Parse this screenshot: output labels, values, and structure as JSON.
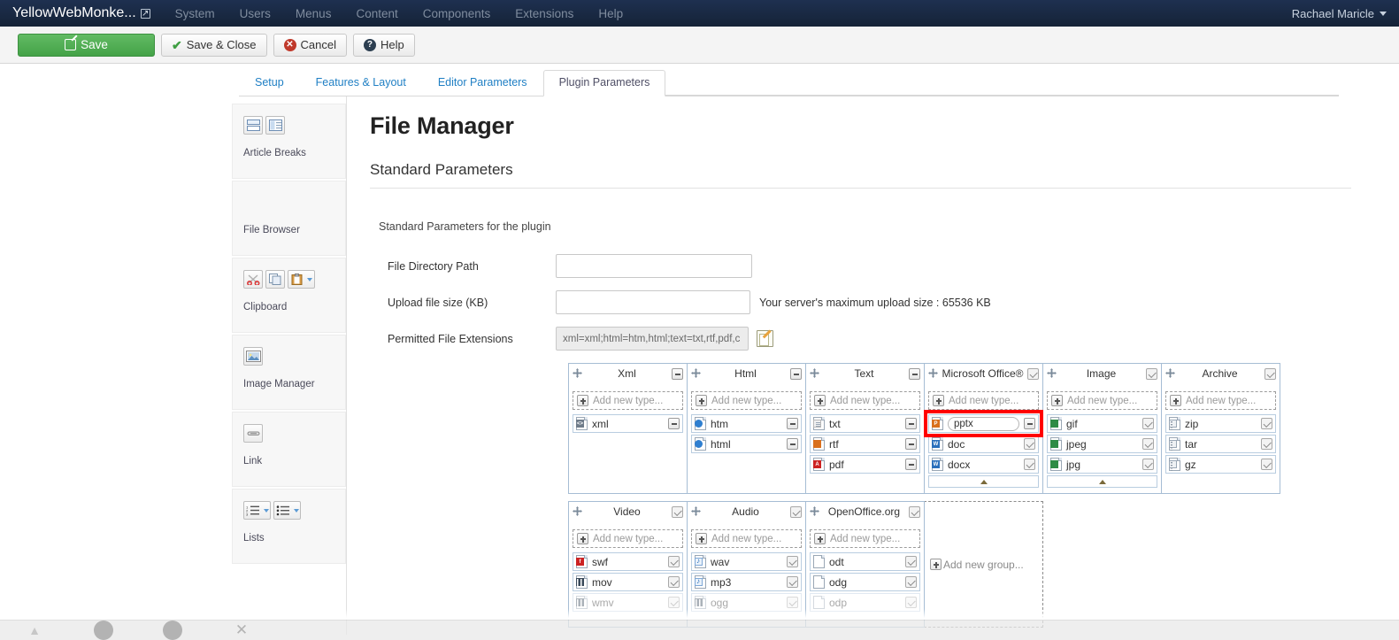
{
  "navbar": {
    "brand": "YellowWebMonke...",
    "brand_icon": "external-link-icon",
    "menu": [
      "System",
      "Users",
      "Menus",
      "Content",
      "Components",
      "Extensions",
      "Help"
    ],
    "user": "Rachael Maricle"
  },
  "toolbar": {
    "save_label": "Save",
    "save_close_label": "Save & Close",
    "cancel_label": "Cancel",
    "help_label": "Help"
  },
  "tabs": [
    {
      "label": "Setup",
      "active": false
    },
    {
      "label": "Features & Layout",
      "active": false
    },
    {
      "label": "Editor Parameters",
      "active": false
    },
    {
      "label": "Plugin Parameters",
      "active": true
    }
  ],
  "sidebar": {
    "items": [
      {
        "label": "Article Breaks",
        "icons": [
          "page-break-icon",
          "page-sidebar-icon"
        ]
      },
      {
        "label": "File Browser",
        "icons": []
      },
      {
        "label": "Clipboard",
        "icons": [
          "cut-scissors-icon",
          "copy-icon",
          "paste-icon"
        ]
      },
      {
        "label": "Image Manager",
        "icons": [
          "image-icon"
        ]
      },
      {
        "label": "Link",
        "icons": [
          "link-icon"
        ]
      },
      {
        "label": "Lists",
        "icons": [
          "ordered-list-icon",
          "unordered-list-icon"
        ]
      }
    ]
  },
  "main": {
    "page_title": "File Manager",
    "section_title": "Standard Parameters",
    "section_desc": "Standard Parameters for the plugin",
    "fields": [
      {
        "label": "File Directory Path",
        "value": "",
        "placeholder": ""
      },
      {
        "label": "Upload file size (KB)",
        "value": "",
        "placeholder": "",
        "helper": "Your server's maximum upload size : 65536 KB"
      },
      {
        "label": "Permitted File Extensions",
        "value": "xml=xml;html=htm,html;text=txt,rtf,pdf,c",
        "readonly": true,
        "edit_icon": "edit-pencil-icon"
      }
    ]
  },
  "groups": {
    "add_new_type_label": "Add new type...",
    "add_new_group_label": "Add new group...",
    "list": [
      {
        "title": "Xml",
        "head_ctl": "minus",
        "row_ctl": "minus",
        "scroll_up": false,
        "types": [
          {
            "label": "xml",
            "icon": "code-file-icon",
            "icon_class": "b-gray",
            "glyph": "<>"
          }
        ]
      },
      {
        "title": "Html",
        "head_ctl": "minus",
        "row_ctl": "minus",
        "scroll_up": false,
        "types": [
          {
            "label": "htm",
            "icon": "globe-file-icon",
            "icon_class": "b-globe",
            "glyph": ""
          },
          {
            "label": "html",
            "icon": "globe-file-icon",
            "icon_class": "b-globe",
            "glyph": ""
          }
        ]
      },
      {
        "title": "Text",
        "head_ctl": "minus",
        "row_ctl": "minus",
        "scroll_up": false,
        "types": [
          {
            "label": "txt",
            "icon": "text-file-icon",
            "icon_class": "b-lines",
            "glyph": ""
          },
          {
            "label": "rtf",
            "icon": "rtf-file-icon",
            "icon_class": "b-orange",
            "glyph": ""
          },
          {
            "label": "pdf",
            "icon": "pdf-file-icon",
            "icon_class": "b-red",
            "glyph": "A"
          }
        ]
      },
      {
        "title": "Microsoft Office®",
        "head_ctl": "check",
        "row_ctl": "check",
        "scroll_up": true,
        "types": [
          {
            "label": "pptx",
            "icon": "powerpoint-file-icon",
            "icon_class": "b-orange",
            "glyph": "P",
            "editing": true,
            "row_ctl": "minus",
            "highlighted": true
          },
          {
            "label": "doc",
            "icon": "word-file-icon",
            "icon_class": "b-blue",
            "glyph": "W"
          },
          {
            "label": "docx",
            "icon": "word-file-icon",
            "icon_class": "b-blue",
            "glyph": "W"
          }
        ]
      },
      {
        "title": "Image",
        "head_ctl": "check",
        "row_ctl": "check",
        "scroll_up": true,
        "types": [
          {
            "label": "gif",
            "icon": "image-file-icon",
            "icon_class": "b-green",
            "glyph": ""
          },
          {
            "label": "jpeg",
            "icon": "image-file-icon",
            "icon_class": "b-green",
            "glyph": ""
          },
          {
            "label": "jpg",
            "icon": "image-file-icon",
            "icon_class": "b-green",
            "glyph": ""
          }
        ]
      },
      {
        "title": "Archive",
        "head_ctl": "check",
        "row_ctl": "check",
        "scroll_up": false,
        "types": [
          {
            "label": "zip",
            "icon": "archive-file-icon",
            "icon_class": "b-zip",
            "glyph": ""
          },
          {
            "label": "tar",
            "icon": "archive-file-icon",
            "icon_class": "b-zip",
            "glyph": ""
          },
          {
            "label": "gz",
            "icon": "archive-file-icon",
            "icon_class": "b-zip",
            "glyph": ""
          }
        ]
      },
      {
        "title": "Video",
        "head_ctl": "check",
        "row_ctl": "check",
        "scroll_up": false,
        "types": [
          {
            "label": "swf",
            "icon": "flash-file-icon",
            "icon_class": "b-red",
            "glyph": "f"
          },
          {
            "label": "mov",
            "icon": "video-file-icon",
            "icon_class": "b-film",
            "glyph": ""
          },
          {
            "label": "wmv",
            "icon": "video-file-icon",
            "icon_class": "b-film",
            "glyph": "",
            "faded": true
          }
        ]
      },
      {
        "title": "Audio",
        "head_ctl": "check",
        "row_ctl": "check",
        "scroll_up": false,
        "types": [
          {
            "label": "wav",
            "icon": "audio-file-icon",
            "icon_class": "b-note",
            "glyph": ""
          },
          {
            "label": "mp3",
            "icon": "audio-file-icon",
            "icon_class": "b-note",
            "glyph": ""
          },
          {
            "label": "ogg",
            "icon": "video-file-icon",
            "icon_class": "b-film",
            "glyph": "",
            "faded": true
          }
        ]
      },
      {
        "title": "OpenOffice.org",
        "head_ctl": "check",
        "row_ctl": "check",
        "scroll_up": false,
        "types": [
          {
            "label": "odt",
            "icon": "blank-file-icon",
            "icon_class": "",
            "glyph": ""
          },
          {
            "label": "odg",
            "icon": "blank-file-icon",
            "icon_class": "",
            "glyph": ""
          },
          {
            "label": "odp",
            "icon": "blank-file-icon",
            "icon_class": "",
            "glyph": "",
            "faded": true
          }
        ]
      }
    ]
  },
  "annotation": {
    "color": "#ff0000",
    "target": "pptx-type-row"
  },
  "taskbar": {
    "items": [
      "taskbar-item-1",
      "taskbar-item-2",
      "taskbar-item-3",
      "taskbar-item-4"
    ]
  }
}
